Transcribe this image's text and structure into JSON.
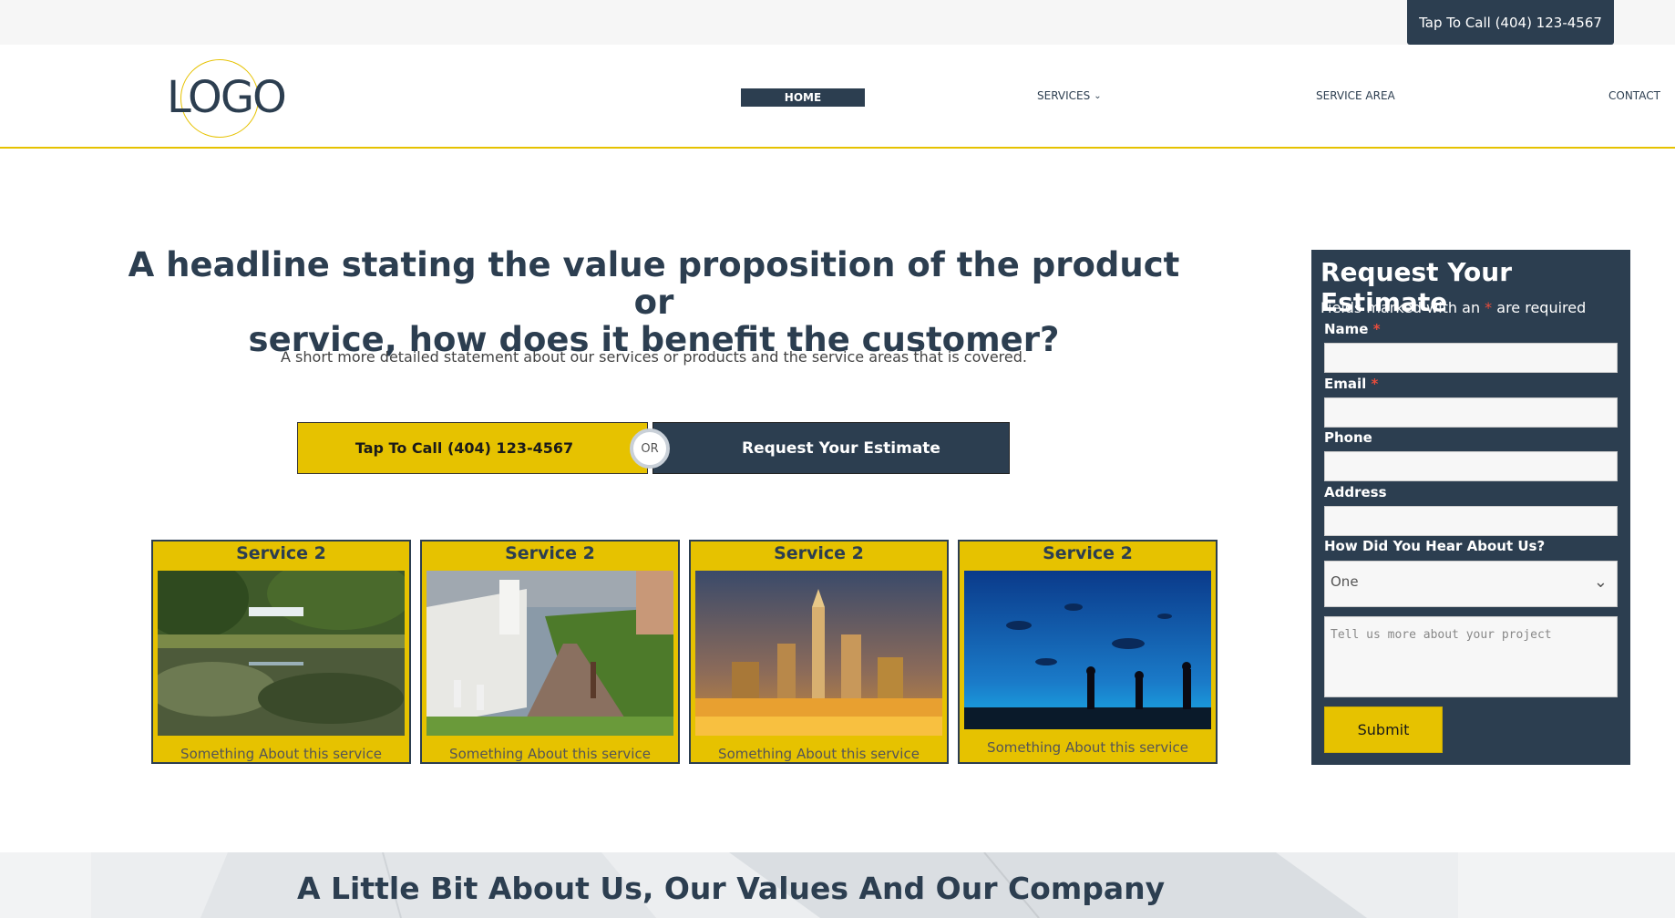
{
  "topbar": {
    "call_label": "Tap To Call (404) 123-4567"
  },
  "logo": {
    "text": "LOGO"
  },
  "nav": {
    "home": "HOME",
    "services": "SERVICES",
    "service_area": "SERVICE AREA",
    "contact": "CONTACT"
  },
  "hero": {
    "headline_line1": "A headline stating the value proposition of the product or",
    "headline_line2": "service, how does it benefit the customer?",
    "subline": "A short more detailed statement about our services or products and the service areas that is covered.",
    "call_button": "Tap To Call (404) 123-4567",
    "or_label": "OR",
    "estimate_button": "Request Your Estimate"
  },
  "services": [
    {
      "title": "Service 2",
      "text": "Something About this service",
      "image": "lake-park-photo"
    },
    {
      "title": "Service 2",
      "text": "Something About this service",
      "image": "garden-walkway-photo"
    },
    {
      "title": "Service 2",
      "text": "Something About this service",
      "image": "city-skyline-night-photo"
    },
    {
      "title": "Service 2",
      "text": "Something About this service",
      "image": "aquarium-photo"
    }
  ],
  "form": {
    "title": "Request Your Estimate",
    "note_before": "Fields marked with an ",
    "note_star": "*",
    "note_after": " are required",
    "name_label": "Name",
    "email_label": "Email",
    "phone_label": "Phone",
    "address_label": "Address",
    "hear_label": "How Did You Hear About Us?",
    "hear_selected": "One",
    "message_placeholder": "Tell us more about your project",
    "required_star": "*",
    "submit": "Submit"
  },
  "about": {
    "title": "A Little Bit About Us, Our Values And Our Company"
  },
  "colors": {
    "navy": "#2c3e50",
    "gold": "#e6c200",
    "required": "#e74c3c"
  }
}
